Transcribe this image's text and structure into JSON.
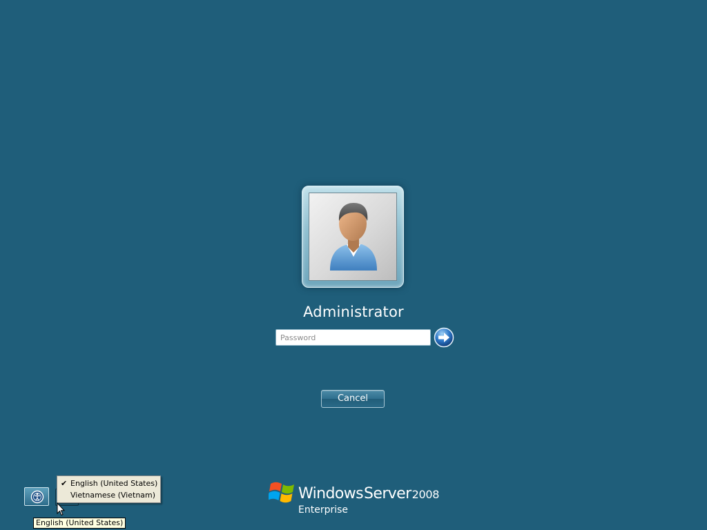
{
  "user": {
    "name": "Administrator",
    "avatar_icon": "user-avatar-icon"
  },
  "login": {
    "password_placeholder": "Password",
    "password_value": "",
    "submit_icon": "arrow-right-icon",
    "cancel_label": "Cancel"
  },
  "taskbar": {
    "ease_of_access_icon": "ease-of-access-icon",
    "language_menu": {
      "items": [
        {
          "label": "English (United States)",
          "checked": true
        },
        {
          "label": "Vietnamese (Vietnam)",
          "checked": false
        }
      ]
    },
    "tooltip": "English (United States)"
  },
  "branding": {
    "windows": "Windows",
    "server": "Server",
    "year": "2008",
    "edition": "Enterprise",
    "logo_icon": "windows-flag-icon"
  },
  "colors": {
    "background": "#1f5e7a",
    "accent": "#2f6f8e",
    "menu_background": "#ece9d8",
    "tooltip_background": "#ffffe1"
  }
}
